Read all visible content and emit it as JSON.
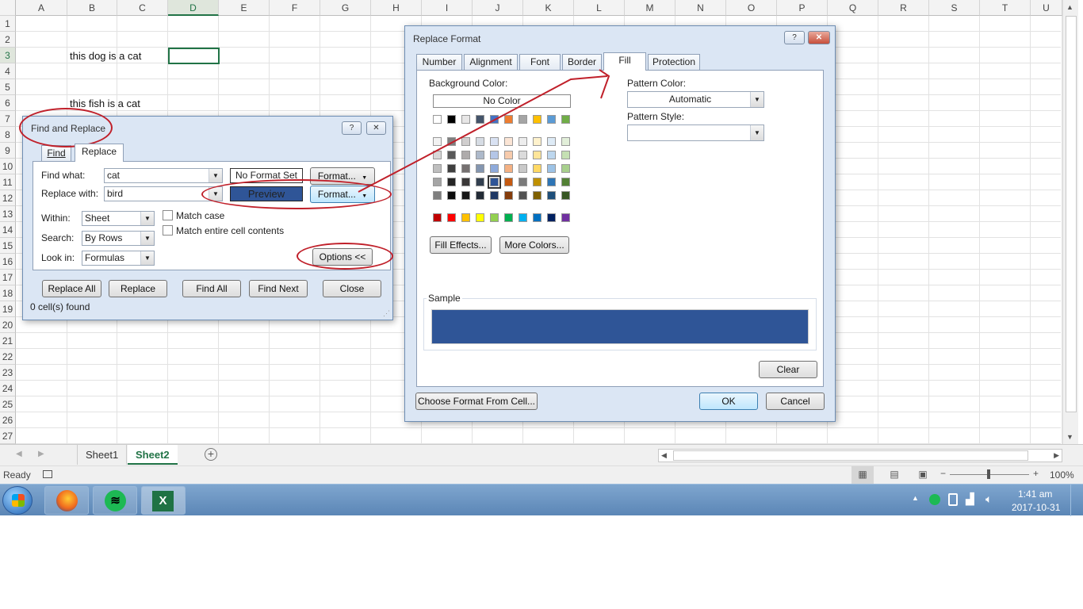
{
  "spreadsheet": {
    "columns": [
      "A",
      "B",
      "C",
      "D",
      "E",
      "F",
      "G",
      "H",
      "I",
      "J",
      "K",
      "L",
      "M",
      "N",
      "O",
      "P",
      "Q",
      "R",
      "S",
      "T",
      "U"
    ],
    "rows": [
      "1",
      "2",
      "3",
      "4",
      "5",
      "6",
      "7",
      "8",
      "9",
      "10",
      "11",
      "12",
      "13",
      "14",
      "15",
      "16",
      "17",
      "18",
      "19",
      "20",
      "21",
      "22",
      "23",
      "24",
      "25",
      "26",
      "27"
    ],
    "selected_column": "D",
    "b3": "this dog is a cat",
    "b6": "this fish is a cat"
  },
  "sheet_tabs": {
    "tab1": "Sheet1",
    "tab2": "Sheet2"
  },
  "status": {
    "ready": "Ready",
    "zoom": "100%"
  },
  "taskbar": {
    "time": "1:41 am",
    "date": "2017-10-31"
  },
  "find_replace": {
    "title": "Find and Replace",
    "help": "?",
    "close": "✕",
    "tab_find": "Find",
    "tab_replace": "Replace",
    "find_what_label": "Find what:",
    "find_what_value": "cat",
    "replace_with_label": "Replace with:",
    "replace_with_value": "bird",
    "no_format_set": "No Format Set",
    "preview": "Preview",
    "format_button": "Format...",
    "within_label": "Within:",
    "within_value": "Sheet",
    "search_label": "Search:",
    "search_value": "By Rows",
    "lookin_label": "Look in:",
    "lookin_value": "Formulas",
    "match_case": "Match case",
    "match_entire": "Match entire cell contents",
    "options": "Options <<",
    "replace_all": "Replace All",
    "replace": "Replace",
    "find_all": "Find All",
    "find_next": "Find Next",
    "close_btn": "Close",
    "found": "0 cell(s) found"
  },
  "replace_format": {
    "title": "Replace Format",
    "help": "?",
    "close": "✕",
    "tabs": [
      "Number",
      "Alignment",
      "Font",
      "Border",
      "Fill",
      "Protection"
    ],
    "bg_color_label": "Background Color:",
    "no_color": "No Color",
    "pattern_color_label": "Pattern Color:",
    "pattern_color_value": "Automatic",
    "pattern_style_label": "Pattern Style:",
    "fill_effects": "Fill Effects...",
    "more_colors": "More Colors...",
    "sample_label": "Sample",
    "sample_color": "#2f5597",
    "clear": "Clear",
    "choose_format": "Choose Format From Cell...",
    "ok": "OK",
    "cancel": "Cancel",
    "theme_row": [
      "#ffffff",
      "#000000",
      "#e7e6e6",
      "#44546a",
      "#4472c4",
      "#ed7d31",
      "#a5a5a5",
      "#ffc000",
      "#5b9bd5",
      "#70ad47"
    ],
    "shade_rows": [
      [
        "#f2f2f2",
        "#7f7f7f",
        "#d0cece",
        "#d6dce4",
        "#d9e2f3",
        "#fbe5d5",
        "#ededed",
        "#fff2cc",
        "#deebf6",
        "#e2efd9"
      ],
      [
        "#d8d8d8",
        "#595959",
        "#aeabab",
        "#adb9ca",
        "#b4c6e7",
        "#f7cbac",
        "#dbdbdb",
        "#fee599",
        "#bdd7ee",
        "#c5e0b3"
      ],
      [
        "#bfbfbf",
        "#3f3f3f",
        "#757070",
        "#8496b0",
        "#8eaadb",
        "#f4b183",
        "#c9c9c9",
        "#ffd965",
        "#9dc3e6",
        "#a8d08d"
      ],
      [
        "#a5a5a5",
        "#262626",
        "#3a3838",
        "#323f4f",
        "#2f5597",
        "#c55a11",
        "#7b7b7b",
        "#bf9000",
        "#2e75b5",
        "#538135"
      ],
      [
        "#7f7f7f",
        "#0c0c0c",
        "#171616",
        "#222a35",
        "#1f3864",
        "#843c0b",
        "#525252",
        "#7f6000",
        "#1e4e79",
        "#375623"
      ]
    ],
    "standard_row": [
      "#c00000",
      "#ff0000",
      "#ffc000",
      "#ffff00",
      "#92d050",
      "#00b050",
      "#00b0f0",
      "#0070c0",
      "#002060",
      "#7030a0"
    ],
    "selected_swatch": "#2f5597"
  }
}
